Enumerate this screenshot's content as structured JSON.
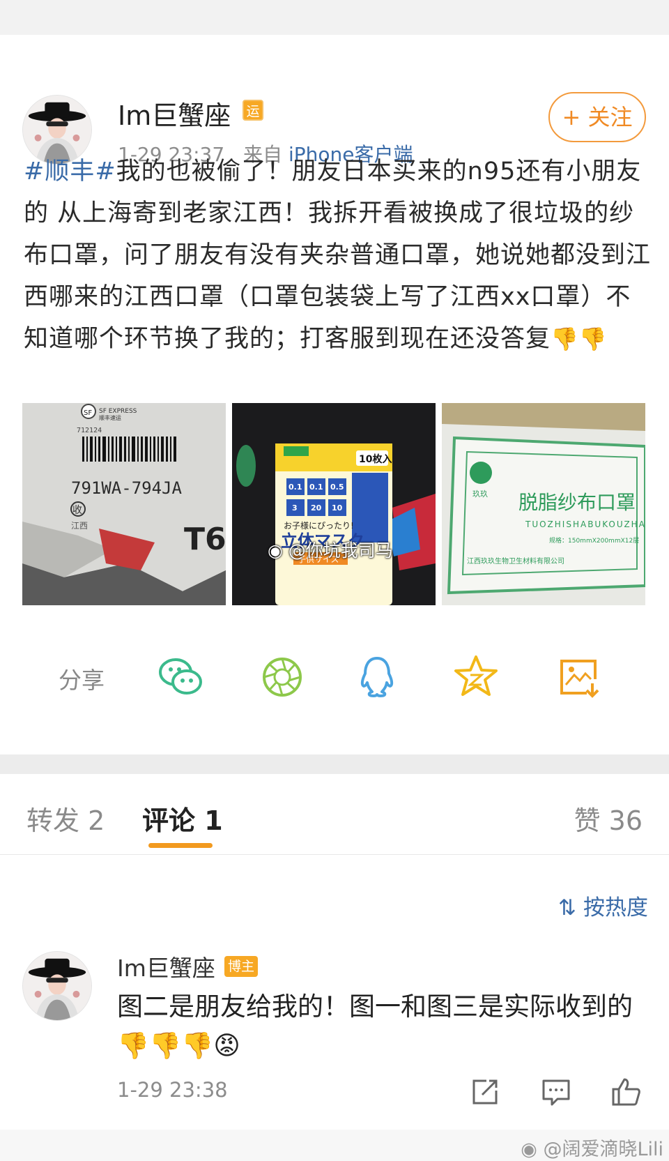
{
  "post": {
    "author": "Im巨蟹座",
    "author_badge": "运",
    "time": "1-29 23:37",
    "source_prefix": "来自",
    "source": "iPhone客户端",
    "follow_label": "+ 关注",
    "hashtag": "#顺丰#",
    "text": "我的也被偷了！朋友日本买来的n95还有小朋友的 从上海寄到老家江西！我拆开看被换成了很垃圾的纱布口罩，问了朋友有没有夹杂普通口罩，她说她都没到江西哪来的江西口罩（口罩包装袋上写了江西xx口罩）不知道哪个环节换了我的；打客服到现在还没答复",
    "text_emoji": "👎👎",
    "image_watermark": "@你坑我司马",
    "photo1": {
      "brand": "SF EXPRESS",
      "brand_cn": "顺丰速运",
      "code": "712124",
      "tracking": "791WA-794JA",
      "stamp": "收",
      "region": "江西",
      "number": "T6"
    },
    "photo2": {
      "count": "10枚入",
      "size_labels": [
        "0.1",
        "0.1",
        "0.5",
        "3",
        "20",
        "10"
      ],
      "title": "立体マスク",
      "subtitle": "子供サイズ",
      "tagline": "お子様にぴったり!"
    },
    "photo3": {
      "brand": "玖玖",
      "product": "脱脂纱布口罩",
      "pinyin": "TUOZHISHABUKOUZHA",
      "spec": "规格：150mmX200mmX12层",
      "maker": "江西玖玖生物卫生材料有限公司"
    }
  },
  "share": {
    "label": "分享",
    "icons": [
      "wechat-icon",
      "moments-icon",
      "qq-icon",
      "qzone-icon",
      "save-image-icon"
    ]
  },
  "tabs": {
    "repost": "转发 2",
    "comment": "评论 1",
    "likes": "赞 36"
  },
  "comments": {
    "sort_label": "按热度",
    "items": [
      {
        "author": "Im巨蟹座",
        "badge": "博主",
        "text": "图二是朋友给我的！图一和图三是实际收到的",
        "emoji": "👎👎👎😡",
        "time": "1-29 23:38"
      }
    ]
  },
  "footer": {
    "watermark": "@阔爱滴晓Lili"
  }
}
